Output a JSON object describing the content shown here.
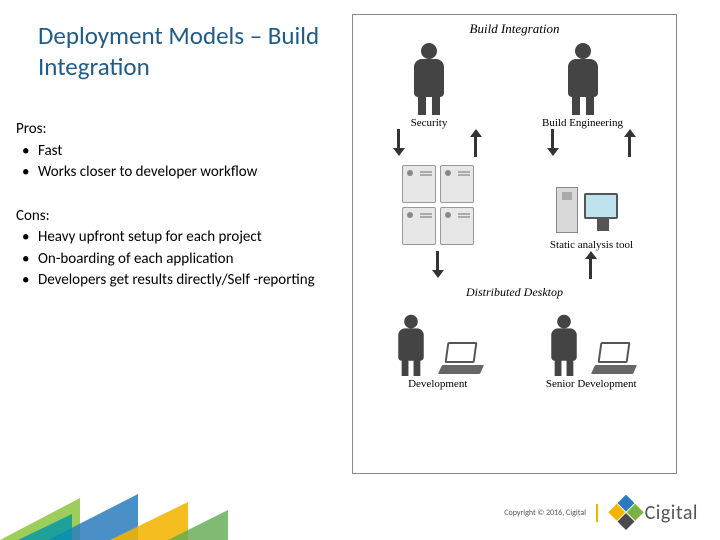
{
  "title": "Deployment Models – Build Integration",
  "pros": {
    "label": "Pros:",
    "items": [
      "Fast",
      "Works closer to developer workflow"
    ]
  },
  "cons": {
    "label": "Cons:",
    "items": [
      "Heavy upfront setup for each project",
      "On-boarding of each application",
      "Developers get results directly/Self -reporting"
    ]
  },
  "diagram": {
    "title": "Build Integration",
    "security": "Security",
    "build_eng": "Build Engineering",
    "static_tool": "Static analysis tool",
    "distributed": "Distributed Desktop",
    "development": "Development",
    "senior_dev": "Senior Development"
  },
  "footer": {
    "copyright": "Copyright © 2016, Cigital",
    "brand": "Cigital"
  }
}
